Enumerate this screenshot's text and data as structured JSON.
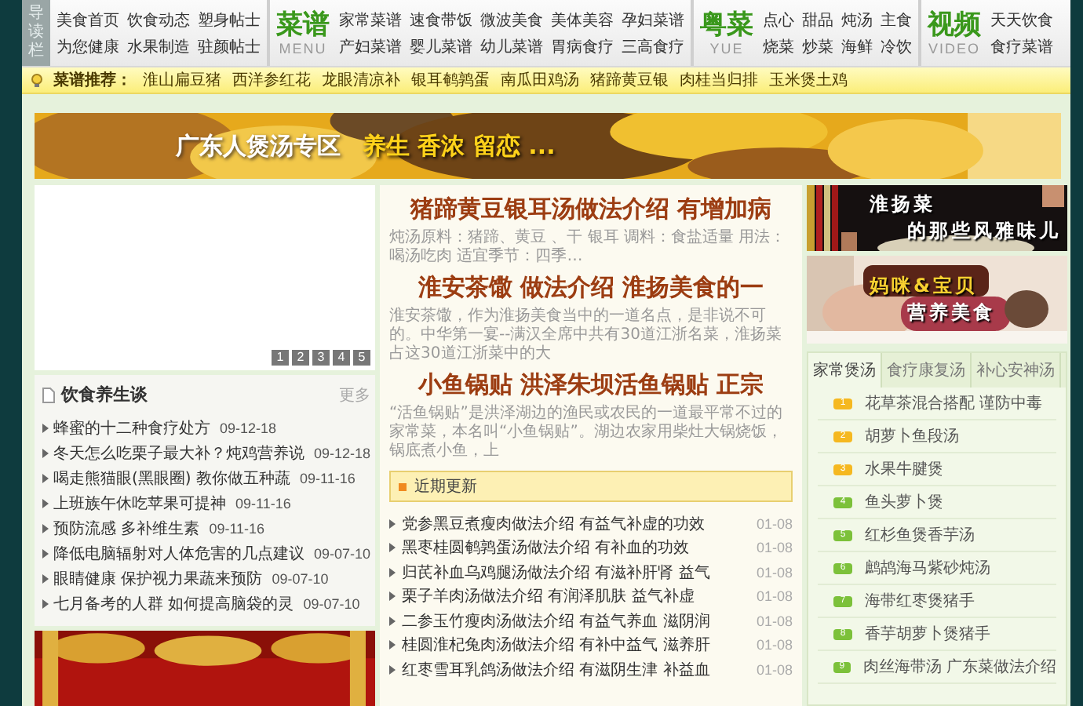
{
  "nav": {
    "side_label": "导读栏",
    "sections": [
      {
        "kind": "plain",
        "links": [
          "美食首页",
          "饮食动态",
          "塑身帖士",
          "为您健康",
          "水果制造",
          "驻颜帖士"
        ]
      },
      {
        "kind": "titled",
        "title": "菜谱",
        "subtitle": "MENU",
        "links": [
          "家常菜谱",
          "速食带饭",
          "微波美食",
          "美体美容",
          "孕妇菜谱",
          "产妇菜谱",
          "婴儿菜谱",
          "幼儿菜谱",
          "胃病食疗",
          "三高食疗"
        ]
      },
      {
        "kind": "titled",
        "title": "粤菜",
        "subtitle": "YUE",
        "links": [
          "点心",
          "甜品",
          "炖汤",
          "主食",
          "烧菜",
          "炒菜",
          "海鲜",
          "冷饮"
        ]
      },
      {
        "kind": "titled",
        "title": "视频",
        "subtitle": "VIDEO",
        "links": [
          "天天饮食",
          "食疗菜谱"
        ]
      }
    ]
  },
  "recommend": {
    "label": "菜谱推荐：",
    "items": [
      "淮山扁豆猪",
      "西洋参红花",
      "龙眼清凉补",
      "银耳鹌鹑蛋",
      "南瓜田鸡汤",
      "猪蹄黄豆银",
      "肉桂当归排",
      "玉米煲土鸡"
    ]
  },
  "banner": {
    "title": "广东人煲汤专区",
    "slogan": "养生 香浓 留恋 ..."
  },
  "slideshow": {
    "pages": [
      {
        "label": "1",
        "selected": false
      },
      {
        "label": "2",
        "selected": false
      },
      {
        "label": "3",
        "selected": false
      },
      {
        "label": "4",
        "selected": false
      },
      {
        "label": "5",
        "selected": false
      }
    ]
  },
  "health_news": {
    "title": "饮食养生谈",
    "more": "更多",
    "items": [
      {
        "text": "蜂蜜的十二种食疗处方",
        "date": "09-12-18"
      },
      {
        "text": "冬天怎么吃栗子最大补？炖鸡营养说",
        "date": "09-12-18"
      },
      {
        "text": "喝走熊猫眼(黑眼圈) 教你做五种蔬",
        "date": "09-11-16"
      },
      {
        "text": "上班族午休吃苹果可提神",
        "date": "09-11-16"
      },
      {
        "text": "预防流感 多补维生素",
        "date": "09-11-16"
      },
      {
        "text": "降低电脑辐射对人体危害的几点建议",
        "date": "09-07-10"
      },
      {
        "text": "眼睛健康 保护视力果蔬来预防",
        "date": "09-07-10"
      },
      {
        "text": "七月备考的人群 如何提高脑袋的灵",
        "date": "09-07-10"
      }
    ]
  },
  "articles": [
    {
      "title": "猪蹄黄豆银耳汤做法介绍 有增加病",
      "summary": "炖汤原料：猪蹄、黄豆 、干 银耳 调料：食盐适量 用法：喝汤吃肉 适宜季节：四季…"
    },
    {
      "title": "淮安茶馓 做法介绍 淮扬美食的一",
      "summary": "淮安茶馓，作为淮扬美食当中的一道名点，是非说不可的。中华第一宴--满汉全席中共有30道江浙名菜，淮扬菜占这30道江浙菜中的大"
    },
    {
      "title": "小鱼锅贴 洪泽朱坝活鱼锅贴 正宗",
      "summary": "“活鱼锅贴”是洪泽湖边的渔民或农民的一道最平常不过的家常菜，本名叫“小鱼锅贴”。湖边农家用柴灶大锅烧饭，锅底煮小鱼，上"
    }
  ],
  "recent": {
    "title": "近期更新",
    "items": [
      {
        "text": "党参黑豆煮瘦肉做法介绍 有益气补虚的功效",
        "date": "01-08"
      },
      {
        "text": "黑枣桂圆鹌鹑蛋汤做法介绍 有补血的功效",
        "date": "01-08"
      },
      {
        "text": "归芪补血乌鸡腿汤做法介绍 有滋补肝肾 益气",
        "date": "01-08"
      },
      {
        "text": "栗子羊肉汤做法介绍 有润泽肌肤 益气补虚",
        "date": "01-08"
      },
      {
        "text": "二参玉竹瘦肉汤做法介绍 有益气养血 滋阴润",
        "date": "01-08"
      },
      {
        "text": "桂圆淮杞兔肉汤做法介绍 有补中益气 滋养肝",
        "date": "01-08"
      },
      {
        "text": "红枣雪耳乳鸽汤做法介绍 有滋阴生津 补益血",
        "date": "01-08"
      }
    ]
  },
  "ads": [
    {
      "line1": "淮扬菜",
      "line2": "的那些风雅味儿"
    },
    {
      "line1": "妈咪&宝贝",
      "line2": "营养美食"
    }
  ],
  "soup_tabs": {
    "tabs": [
      {
        "label": "家常煲汤",
        "selected": true
      },
      {
        "label": "食疗康复汤",
        "selected": false
      },
      {
        "label": "补心安神汤",
        "selected": false
      }
    ],
    "items": [
      {
        "num": "1",
        "text": "花草茶混合搭配 谨防中毒",
        "color": "#f5b820"
      },
      {
        "num": "2",
        "text": "胡萝卜鱼段汤",
        "color": "#f5b820"
      },
      {
        "num": "3",
        "text": "水果牛腱煲",
        "color": "#f5b820"
      },
      {
        "num": "4",
        "text": "鱼头萝卜煲",
        "color": "#7cc13a"
      },
      {
        "num": "5",
        "text": "红杉鱼煲香芋汤",
        "color": "#7cc13a"
      },
      {
        "num": "6",
        "text": "鹧鸪海马紫砂炖汤",
        "color": "#7cc13a"
      },
      {
        "num": "7",
        "text": "海带红枣煲猪手",
        "color": "#7cc13a"
      },
      {
        "num": "8",
        "text": "香芋胡萝卜煲猪手",
        "color": "#7cc13a"
      },
      {
        "num": "9",
        "text": "肉丝海带汤 广东菜做法介绍",
        "color": "#7cc13a"
      }
    ]
  }
}
